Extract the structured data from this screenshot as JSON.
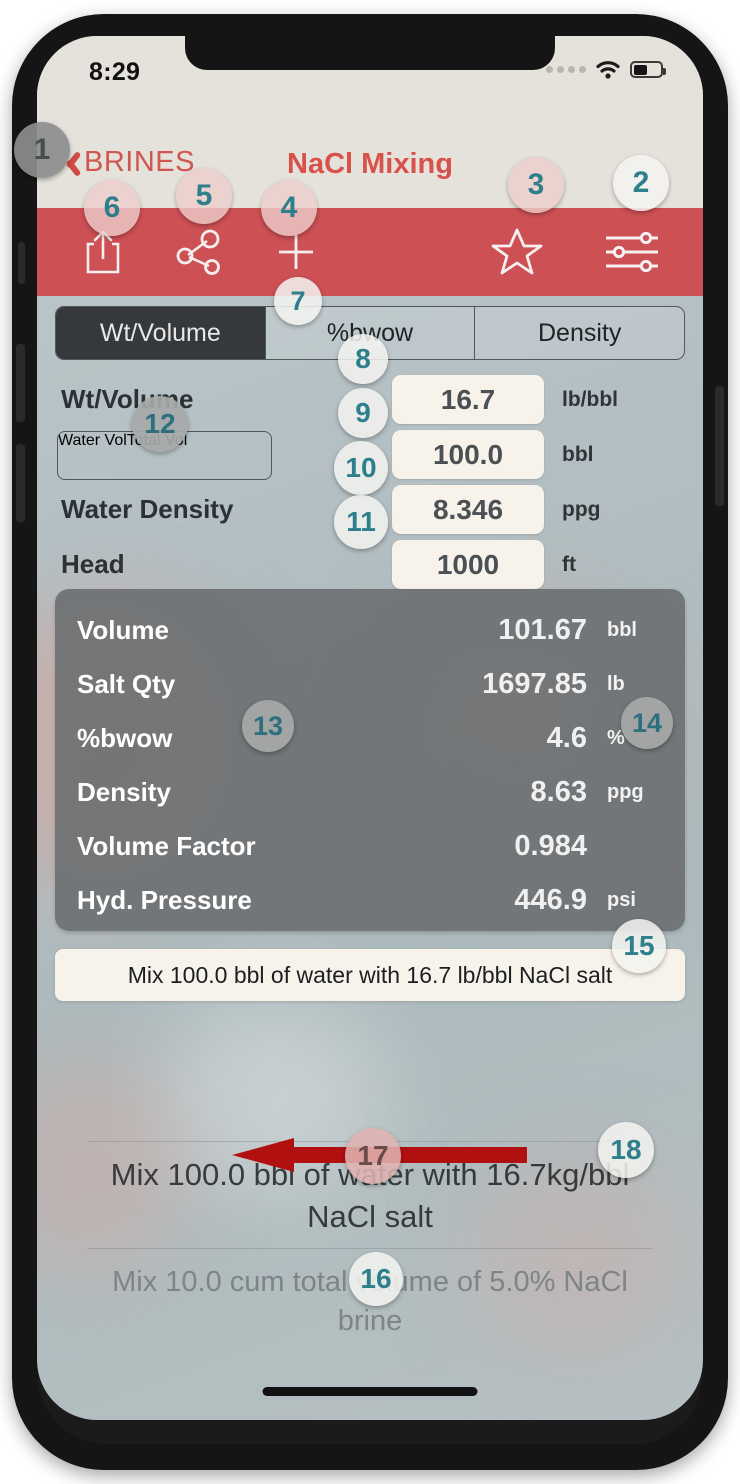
{
  "status_bar": {
    "time": "8:29",
    "signal_dots": 4,
    "wifi_icon": "wifi-icon",
    "battery_icon": "battery-icon",
    "battery_level": "50"
  },
  "nav": {
    "back_label": "BRINES",
    "back_icon": "chevron-left-icon",
    "title": "NaCl Mixing",
    "accent": "#d8524b"
  },
  "toolbar": {
    "background": "#cd5055",
    "items": [
      {
        "name": "share-icon",
        "label": "Share"
      },
      {
        "name": "share-nodes-icon",
        "label": "Share Nodes"
      },
      {
        "name": "plus-icon",
        "label": "Add"
      },
      {
        "name": "star-icon",
        "label": "Favorite"
      },
      {
        "name": "sliders-icon",
        "label": "Settings"
      }
    ]
  },
  "segments": {
    "options": [
      "Wt/Volume",
      "%bwow",
      "Density"
    ],
    "selected": "Wt/Volume"
  },
  "inputs": [
    {
      "label": "Wt/Volume",
      "value": "16.7",
      "unit": "lb/bbl"
    },
    {
      "label": "",
      "value": "100.0",
      "unit": "bbl",
      "toggle": {
        "options": [
          "Water Vol",
          "Total Vol"
        ],
        "selected": "Water Vol"
      }
    },
    {
      "label": "Water Density",
      "value": "8.346",
      "unit": "ppg"
    },
    {
      "label": "Head",
      "value": "1000",
      "unit": "ft"
    }
  ],
  "results": [
    {
      "label": "Volume",
      "value": "101.67",
      "unit": "bbl"
    },
    {
      "label": "Salt Qty",
      "value": "1697.85",
      "unit": "lb"
    },
    {
      "label": "%bwow",
      "value": "4.6",
      "unit": "%"
    },
    {
      "label": "Density",
      "value": "8.63",
      "unit": "ppg"
    },
    {
      "label": "Volume Factor",
      "value": "0.984",
      "unit": ""
    },
    {
      "label": "Hyd. Pressure",
      "value": "446.9",
      "unit": "psi"
    }
  ],
  "summary": {
    "text": "Mix 100.0 bbl of water with 16.7 lb/bbl NaCl salt"
  },
  "faded": {
    "main": "Mix 100.0 bbl of water with 16.7kg/bbl NaCl salt",
    "sub": "Mix 10.0 cum total volume of 5.0% NaCl brine"
  },
  "annotations": {
    "n1": "1",
    "n2": "2",
    "n3": "3",
    "n4": "4",
    "n5": "5",
    "n6": "6",
    "n7": "7",
    "n8": "8",
    "n9": "9",
    "n10": "10",
    "n11": "11",
    "n12": "12",
    "n13": "13",
    "n14": "14",
    "n15": "15",
    "n16": "16",
    "n17": "17",
    "n18": "18"
  },
  "arrow": {
    "name": "red-annotation-arrow",
    "color": "#b01010"
  }
}
